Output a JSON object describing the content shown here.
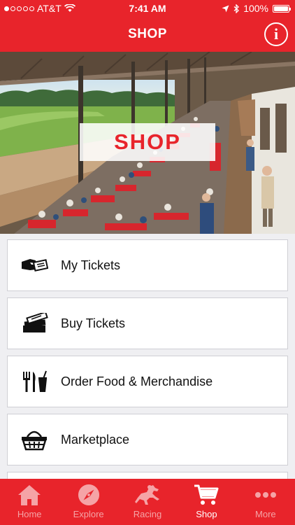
{
  "status_bar": {
    "carrier": "AT&T",
    "time": "7:41 AM",
    "battery": "100%"
  },
  "header": {
    "title": "SHOP"
  },
  "hero": {
    "badge_text": "SHOP"
  },
  "menu": {
    "items": [
      {
        "label": "My Tickets",
        "icon": "ticket-hand-icon"
      },
      {
        "label": "Buy Tickets",
        "icon": "ticket-stack-icon"
      },
      {
        "label": "Order Food & Merchandise",
        "icon": "utensils-drink-icon"
      },
      {
        "label": "Marketplace",
        "icon": "basket-icon"
      }
    ]
  },
  "tab_bar": {
    "tabs": [
      {
        "label": "Home",
        "icon": "home-icon"
      },
      {
        "label": "Explore",
        "icon": "compass-icon"
      },
      {
        "label": "Racing",
        "icon": "horse-icon"
      },
      {
        "label": "Shop",
        "icon": "cart-icon"
      },
      {
        "label": "More",
        "icon": "more-icon"
      }
    ],
    "active": "Shop"
  },
  "colors": {
    "brand_red": "#e8242b",
    "inactive_tab": "#f5a3a6"
  }
}
